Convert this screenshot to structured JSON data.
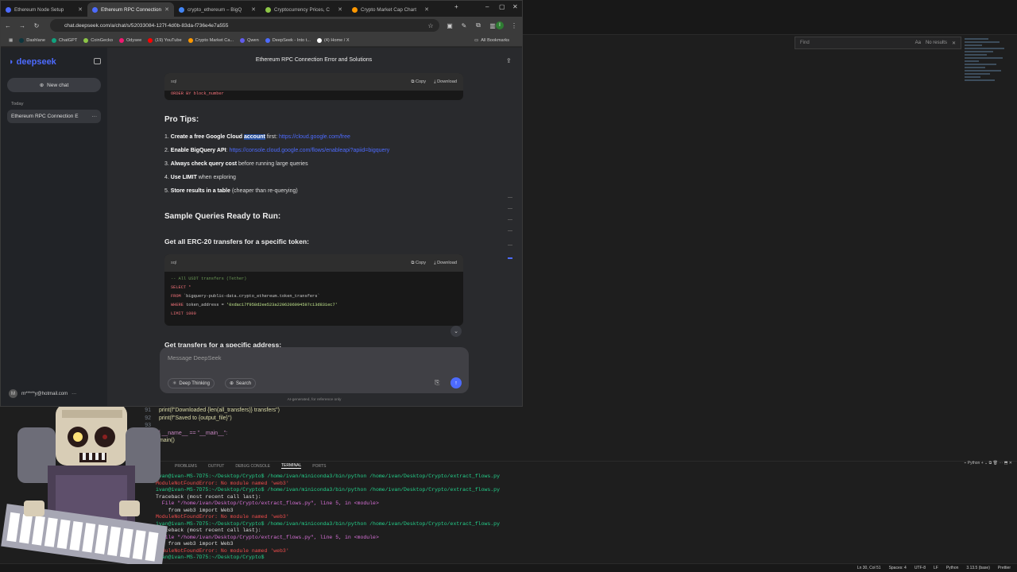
{
  "browser": {
    "tabs": [
      {
        "title": "Ethereum Node Setup",
        "active": false,
        "color": "#4d6bfe"
      },
      {
        "title": "Ethereum RPC Connection",
        "active": true,
        "color": "#4d6bfe"
      },
      {
        "title": "crypto_ethereum – BigQ",
        "active": false,
        "color": "#4285f4"
      },
      {
        "title": "Cryptocurrency Prices, C",
        "active": false,
        "color": "#8dc647"
      },
      {
        "title": "Crypto Market Cap Chart",
        "active": false,
        "color": "#ff9800"
      }
    ],
    "url": "chat.deepseek.com/a/chat/s/52033084-127f-4d0b-83da-f736e4e7a555",
    "profile_initial": "I",
    "bookmarks": [
      {
        "label": "Dashlane",
        "color": "#0e353d"
      },
      {
        "label": "ChatGPT",
        "color": "#10a37f"
      },
      {
        "label": "CoinGecko",
        "color": "#8dc647"
      },
      {
        "label": "Odysee",
        "color": "#ef1970"
      },
      {
        "label": "(19) YouTube",
        "color": "#ff0000"
      },
      {
        "label": "Crypto Market Ca...",
        "color": "#ff9800"
      },
      {
        "label": "Qwen",
        "color": "#615ced"
      },
      {
        "label": "DeepSeek - Into t...",
        "color": "#4d6bfe"
      },
      {
        "label": "(4) Home / X",
        "color": "#ffffff"
      }
    ],
    "all_bookmarks": "All Bookmarks"
  },
  "deepseek": {
    "logo": "deepseek",
    "new_chat": "New chat",
    "today": "Today",
    "chat_item": "Ethereum RPC Connection E",
    "user_email": "m*****y@hotmail.com",
    "user_initial": "M",
    "title": "Ethereum RPC Connection Error and Solutions",
    "copy": "Copy",
    "download": "Download",
    "code1_lang": "sql",
    "code1_line": "ORDER BY block_number",
    "pro_tips_heading": "Pro Tips:",
    "tips": [
      {
        "num": "1.",
        "bold": "Create a free Google Cloud",
        "hl": "account",
        "rest": " first: ",
        "link": "https://cloud.google.com/free"
      },
      {
        "num": "2.",
        "bold": "Enable BigQuery API",
        "hl": "",
        "rest": ": ",
        "link": "https://console.cloud.google.com/flows/enableapi?apiid=bigquery"
      },
      {
        "num": "3.",
        "bold": "Always check query cost",
        "hl": "",
        "rest": " before running large queries",
        "link": ""
      },
      {
        "num": "4.",
        "bold": "Use LIMIT",
        "hl": "",
        "rest": " when exploring",
        "link": ""
      },
      {
        "num": "5.",
        "bold": "Store results in a table",
        "hl": "",
        "rest": " (cheaper than re-querying)",
        "link": ""
      }
    ],
    "sample_heading": "Sample Queries Ready to Run:",
    "erc20_heading": "Get all ERC-20 transfers for a specific token:",
    "code2_lang": "sql",
    "code2": {
      "comment": "-- All USDT transfers (Tether)",
      "select": "SELECT *",
      "from_kw": "FROM",
      "from_val": "`bigquery-public-data.crypto_ethereum.token_transfers`",
      "where_kw": "WHERE",
      "where_field": "token_address = ",
      "where_val": "'0xdac17f958d2ee523a2206206994597c13d831ec7'",
      "limit": "LIMIT 1000"
    },
    "next_heading": "Get transfers for a specific address:",
    "input_placeholder": "Message DeepSeek",
    "deep_thinking": "Deep Thinking",
    "search": "Search",
    "disclaimer": "AI-generated, for reference only"
  },
  "vscode": {
    "find_placeholder": "Find",
    "find_aa": "Aa",
    "find_results": "No results",
    "code_lines": [
      {
        "n": "91",
        "t": "        print(f\"Downloaded {len(all_transfers)} transfers\")"
      },
      {
        "n": "92",
        "t": "        print(f\"Saved to {output_file}\")"
      },
      {
        "n": "93",
        "t": ""
      },
      {
        "n": "94",
        "t": "if __name__ == \"__main__\":"
      },
      {
        "n": "95",
        "t": "    main()"
      }
    ],
    "panel_tabs": [
      "PROBLEMS",
      "OUTPUT",
      "DEBUG CONSOLE",
      "TERMINAL",
      "PORTS"
    ],
    "panel_active": "TERMINAL",
    "terminal_kind": "Python",
    "terminal": [
      {
        "c": "tg",
        "t": "ivan@ivan-MS-7D75:~/Desktop/Crypto$ /home/ivan/miniconda3/bin/python /home/ivan/Desktop/Crypto/extract_flows.py"
      },
      {
        "c": "tr",
        "t": "ModuleNotFoundError: No module named 'web3'"
      },
      {
        "c": "tg",
        "t": "ivan@ivan-MS-7D75:~/Desktop/Crypto$ /home/ivan/miniconda3/bin/python /home/ivan/Desktop/Crypto/extract_flows.py"
      },
      {
        "c": "",
        "t": "Traceback (most recent call last):"
      },
      {
        "c": "tm",
        "t": "  File \"/home/ivan/Desktop/Crypto/extract_flows.py\", line 5, in <module>"
      },
      {
        "c": "",
        "t": "    from web3 import Web3"
      },
      {
        "c": "tr",
        "t": "ModuleNotFoundError: No module named 'web3'"
      },
      {
        "c": "tg",
        "t": "ivan@ivan-MS-7D75:~/Desktop/Crypto$ /home/ivan/miniconda3/bin/python /home/ivan/Desktop/Crypto/extract_flows.py"
      },
      {
        "c": "",
        "t": "Traceback (most recent call last):"
      },
      {
        "c": "tm",
        "t": "  File \"/home/ivan/Desktop/Crypto/extract_flows.py\", line 5, in <module>"
      },
      {
        "c": "",
        "t": "    from web3 import Web3"
      },
      {
        "c": "tr",
        "t": "ModuleNotFoundError: No module named 'web3'"
      },
      {
        "c": "tg",
        "t": "ivan@ivan-MS-7D75:~/Desktop/Crypto$ "
      }
    ],
    "status": {
      "position": "Ln 30, Col 51",
      "spaces": "Spaces: 4",
      "encoding": "UTF-8",
      "eol": "LF",
      "language": "Python",
      "interpreter": "3.13.5 (base)",
      "formatter": "Prettier"
    }
  }
}
